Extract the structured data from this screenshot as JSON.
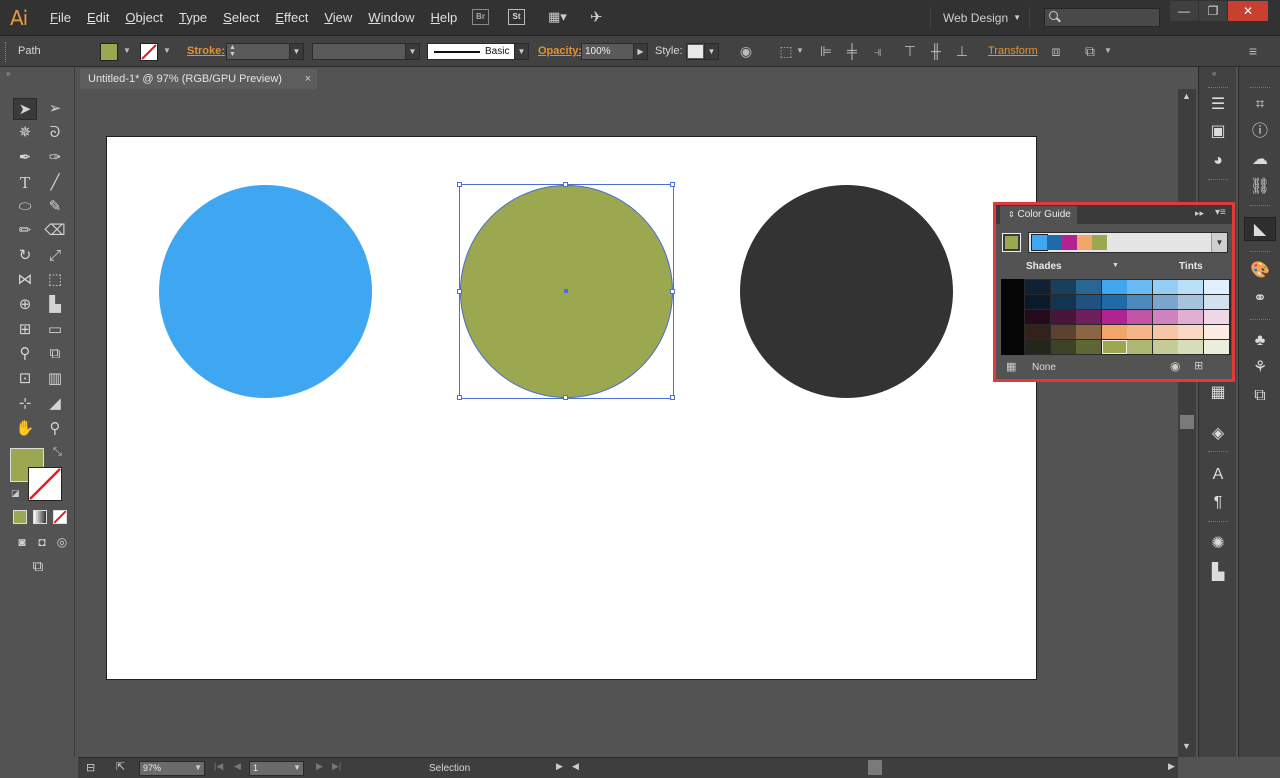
{
  "app": {
    "logo": "Ai"
  },
  "menu": [
    "File",
    "Edit",
    "Object",
    "Type",
    "Select",
    "Effect",
    "View",
    "Window",
    "Help"
  ],
  "bridge_icons": [
    "Br",
    "St"
  ],
  "workspace": {
    "label": "Web Design"
  },
  "control_bar": {
    "object_type": "Path",
    "stroke_label": "Stroke:",
    "brush_label": "Basic",
    "opacity_label": "Opacity:",
    "opacity_value": "100%",
    "style_label": "Style:",
    "transform_label": "Transform",
    "fill_color": "#9ba850"
  },
  "document": {
    "tab_title": "Untitled-1* @ 97% (RGB/GPU Preview)",
    "close": "×"
  },
  "artwork": {
    "circles": [
      {
        "name": "blue",
        "color": "#3fa6f2"
      },
      {
        "name": "olive",
        "color": "#9ba850",
        "selected": true
      },
      {
        "name": "dark",
        "color": "#333333"
      }
    ]
  },
  "tools": {
    "fill_color": "#9ba850",
    "stroke": "none"
  },
  "status": {
    "zoom": "97%",
    "artboard": "1",
    "tool": "Selection"
  },
  "color_guide": {
    "title": "Color Guide",
    "selected_color": "#9ba850",
    "harmony": [
      "#3fa6f2",
      "#1f6ba8",
      "#b3238f",
      "#f2a56b",
      "#9ba850"
    ],
    "left_label": "Shades",
    "right_label": "Tints",
    "footer_label": "None",
    "grid": [
      [
        "#0e2233",
        "#1a3f5e",
        "#2a6692",
        "#3fa6f2",
        "#6abaf3",
        "#94cdf6",
        "#bcdff9",
        "#e0f0fc"
      ],
      [
        "#0a1a28",
        "#133451",
        "#1f527f",
        "#1f6ba8",
        "#4c89bc",
        "#7aa6cd",
        "#a6c3de",
        "#d2e1ee"
      ],
      [
        "#230b1c",
        "#471539",
        "#6e1e58",
        "#b3238f",
        "#c154a5",
        "#cf82bb",
        "#dfb0d2",
        "#efd8e8"
      ],
      [
        "#312319",
        "#5c4230",
        "#8a6547",
        "#f2a56b",
        "#f4b68a",
        "#f6c7a6",
        "#f9d9c3",
        "#fcece1"
      ],
      [
        "#23261a",
        "#3d4326",
        "#5e6634",
        "#9ba850",
        "#afb973",
        "#c3cb96",
        "#d7dcb9",
        "#ebeedc"
      ]
    ]
  }
}
